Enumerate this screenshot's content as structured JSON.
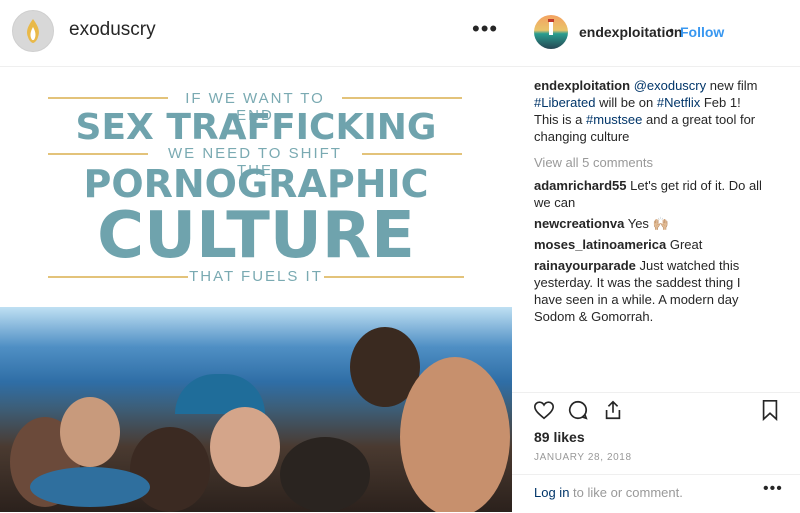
{
  "post_header": {
    "username": "exoduscry",
    "more_glyph": "•••"
  },
  "poster": {
    "line1": "IF WE WANT TO END",
    "line2": "SEX TRAFFICKING",
    "line3": "WE NEED TO SHIFT THE",
    "line4": "PORNOGRAPHIC",
    "line5": "CULTURE",
    "line6": "THAT FUELS IT"
  },
  "side_header": {
    "username": "endexploitation",
    "dot": "•",
    "follow_label": "Follow"
  },
  "caption": {
    "username": "endexploitation",
    "mention": "@exoduscry",
    "text1": " new film ",
    "hashtag1": "#Liberated",
    "text2": " will be on ",
    "hashtag2": "#Netflix",
    "text3": " Feb 1! This is a ",
    "hashtag3": "#mustsee",
    "text4": " and a great tool for changing culture"
  },
  "view_all": "View all 5 comments",
  "comments": [
    {
      "user": "adamrichard55",
      "text": "Let's get rid of it. Do all we can"
    },
    {
      "user": "newcreationva",
      "text": "Yes 🙌🏼"
    },
    {
      "user": "moses_latinoamerica",
      "text": "Great"
    },
    {
      "user": "rainayourparade",
      "text": "Just watched this yesterday. It was the saddest thing I have seen in a while. A modern day Sodom & Gomorrah."
    }
  ],
  "likes": "89 likes",
  "date": "JANUARY 28, 2018",
  "login": {
    "link": "Log in",
    "rest": " to like or comment."
  },
  "icons": [
    "heart-icon",
    "comment-icon",
    "share-icon",
    "bookmark-icon",
    "more-icon"
  ],
  "colors": {
    "follow": "#3897f0",
    "link": "#003569",
    "muted": "#999999",
    "poster_teal": "#6fa3ad",
    "poster_gold": "#e3c37a"
  }
}
